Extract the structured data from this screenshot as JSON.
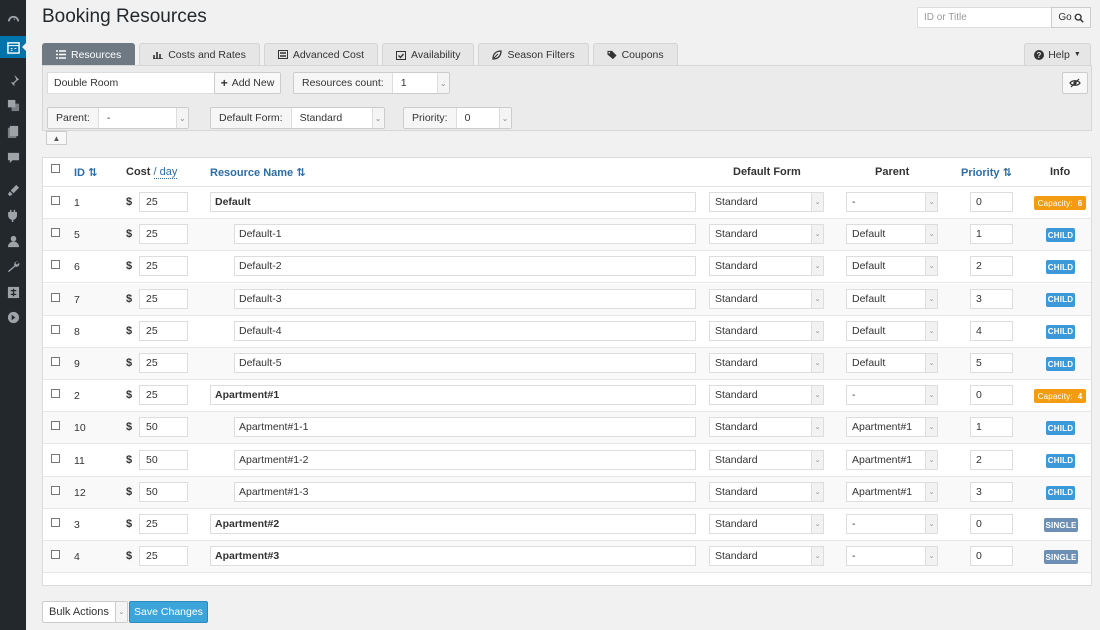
{
  "page": {
    "title": "Booking Resources"
  },
  "search": {
    "placeholder": "ID or Title",
    "go_label": "Go"
  },
  "tabs": [
    {
      "label": "Resources",
      "icon": "list-icon",
      "active": true
    },
    {
      "label": "Costs and Rates",
      "icon": "bar-chart-icon"
    },
    {
      "label": "Advanced Cost",
      "icon": "calculator-icon"
    },
    {
      "label": "Availability",
      "icon": "calendar-check-icon"
    },
    {
      "label": "Season Filters",
      "icon": "leaf-icon"
    },
    {
      "label": "Coupons",
      "icon": "tag-icon"
    }
  ],
  "help": {
    "label": "Help"
  },
  "toolbar": {
    "new_name_value": "Double Room",
    "add_new_label": "Add New",
    "count_label": "Resources count:",
    "count_value": "1",
    "parent_label": "Parent:",
    "parent_value": "-",
    "form_label": "Default Form:",
    "form_value": "Standard",
    "priority_label": "Priority:",
    "priority_value": "0"
  },
  "table": {
    "headers": {
      "id": "ID",
      "cost": "Cost",
      "cost_unit": "/ day",
      "name": "Resource Name",
      "form": "Default Form",
      "parent": "Parent",
      "priority": "Priority",
      "info": "Info"
    },
    "currency": "$",
    "rows": [
      {
        "id": "1",
        "cost": "25",
        "name": "Default",
        "level": "parent",
        "form": "Standard",
        "parent": "-",
        "priority": "0",
        "badge": "capacity",
        "badge_label": "Capacity:",
        "badge_value": "6"
      },
      {
        "id": "5",
        "cost": "25",
        "name": "Default-1",
        "level": "child",
        "form": "Standard",
        "parent": "Default",
        "priority": "1",
        "badge": "child",
        "badge_label": "CHILD"
      },
      {
        "id": "6",
        "cost": "25",
        "name": "Default-2",
        "level": "child",
        "form": "Standard",
        "parent": "Default",
        "priority": "2",
        "badge": "child",
        "badge_label": "CHILD"
      },
      {
        "id": "7",
        "cost": "25",
        "name": "Default-3",
        "level": "child",
        "form": "Standard",
        "parent": "Default",
        "priority": "3",
        "badge": "child",
        "badge_label": "CHILD"
      },
      {
        "id": "8",
        "cost": "25",
        "name": "Default-4",
        "level": "child",
        "form": "Standard",
        "parent": "Default",
        "priority": "4",
        "badge": "child",
        "badge_label": "CHILD"
      },
      {
        "id": "9",
        "cost": "25",
        "name": "Default-5",
        "level": "child",
        "form": "Standard",
        "parent": "Default",
        "priority": "5",
        "badge": "child",
        "badge_label": "CHILD"
      },
      {
        "id": "2",
        "cost": "25",
        "name": "Apartment#1",
        "level": "parent",
        "form": "Standard",
        "parent": "-",
        "priority": "0",
        "badge": "capacity",
        "badge_label": "Capacity:",
        "badge_value": "4"
      },
      {
        "id": "10",
        "cost": "50",
        "name": "Apartment#1-1",
        "level": "child",
        "form": "Standard",
        "parent": "Apartment#1",
        "priority": "1",
        "badge": "child",
        "badge_label": "CHILD"
      },
      {
        "id": "11",
        "cost": "50",
        "name": "Apartment#1-2",
        "level": "child",
        "form": "Standard",
        "parent": "Apartment#1",
        "priority": "2",
        "badge": "child",
        "badge_label": "CHILD"
      },
      {
        "id": "12",
        "cost": "50",
        "name": "Apartment#1-3",
        "level": "child",
        "form": "Standard",
        "parent": "Apartment#1",
        "priority": "3",
        "badge": "child",
        "badge_label": "CHILD"
      },
      {
        "id": "3",
        "cost": "25",
        "name": "Apartment#2",
        "level": "parent",
        "form": "Standard",
        "parent": "-",
        "priority": "0",
        "badge": "single",
        "badge_label": "SINGLE"
      },
      {
        "id": "4",
        "cost": "25",
        "name": "Apartment#3",
        "level": "parent",
        "form": "Standard",
        "parent": "-",
        "priority": "0",
        "badge": "single",
        "badge_label": "SINGLE"
      }
    ]
  },
  "footer": {
    "bulk_label": "Bulk Actions",
    "save_label": "Save Changes"
  },
  "colors": {
    "accent": "#3ba5d9",
    "active_tab": "#6e7983",
    "capacity_badge": "#f39c12",
    "child_badge": "#3a99d8",
    "single_badge": "#6d8fb3"
  }
}
